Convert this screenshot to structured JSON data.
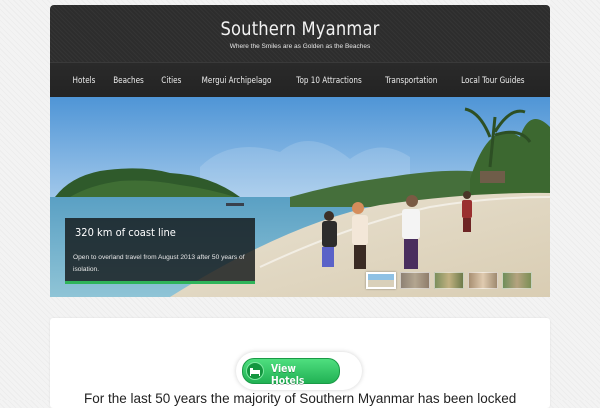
{
  "header": {
    "title": "Southern Myanmar",
    "tagline": "Where the Smiles are as Golden as the Beaches"
  },
  "nav": {
    "items": [
      {
        "label": "Hotels"
      },
      {
        "label": "Beaches"
      },
      {
        "label": "Cities"
      },
      {
        "label": "Mergui Archipelago"
      },
      {
        "label": "Top 10 Attractions"
      },
      {
        "label": "Transportation"
      },
      {
        "label": "Local Tour Guides"
      }
    ]
  },
  "slider": {
    "caption_title": "320 km of coast line",
    "caption_text": "Open to overland travel from August 2013 after 50 years of isolation.",
    "thumbnails": [
      "beach",
      "stone",
      "market",
      "kids",
      "forest"
    ],
    "active_thumbnail": 1
  },
  "cta": {
    "label": "View Hotels",
    "icon": "bed-icon"
  },
  "intro": {
    "text": "For the last 50 years the majority of Southern Myanmar has been locked"
  },
  "colors": {
    "header_bg": "#2d2d2d",
    "accent_green": "#2fb45a",
    "page_bg": "#f3f3f3"
  }
}
